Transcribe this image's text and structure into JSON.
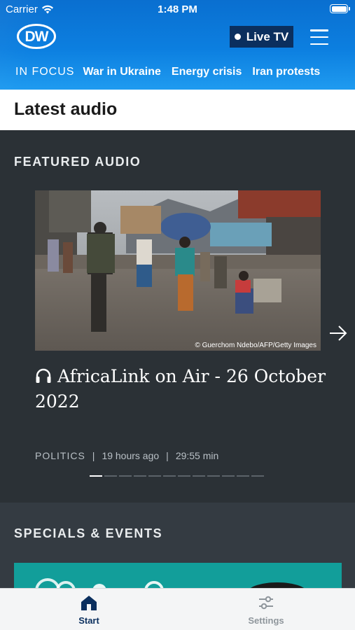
{
  "status_bar": {
    "carrier": "Carrier",
    "time": "1:48 PM"
  },
  "header": {
    "logo": "DW",
    "live_tv_label": "Live TV",
    "in_focus_label": "IN FOCUS",
    "topics": [
      "War in Ukraine",
      "Energy crisis",
      "Iran protests"
    ]
  },
  "page": {
    "title": "Latest audio"
  },
  "featured": {
    "section_label": "FEATURED AUDIO",
    "photo_credit": "© Guerchom Ndebo/AFP/Getty Images",
    "title": "AfricaLink on Air - 26 October 2022",
    "category": "POLITICS",
    "separator": "|",
    "age": "19 hours ago",
    "duration": "29:55 min",
    "pager": {
      "total": 12,
      "current": 1
    }
  },
  "specials": {
    "section_label": "SPECIALS & EVENTS"
  },
  "tabbar": {
    "start_label": "Start",
    "settings_label": "Settings"
  },
  "colors": {
    "brand_blue": "#0c7fe0",
    "navy": "#0b2f5e",
    "dark_bg": "#2b3136",
    "teal": "#129e9a"
  },
  "icons": [
    "wifi-icon",
    "battery-icon",
    "dw-logo",
    "live-dot-icon",
    "hamburger-menu-icon",
    "headphones-icon",
    "arrow-right-icon",
    "home-icon",
    "sliders-icon"
  ]
}
